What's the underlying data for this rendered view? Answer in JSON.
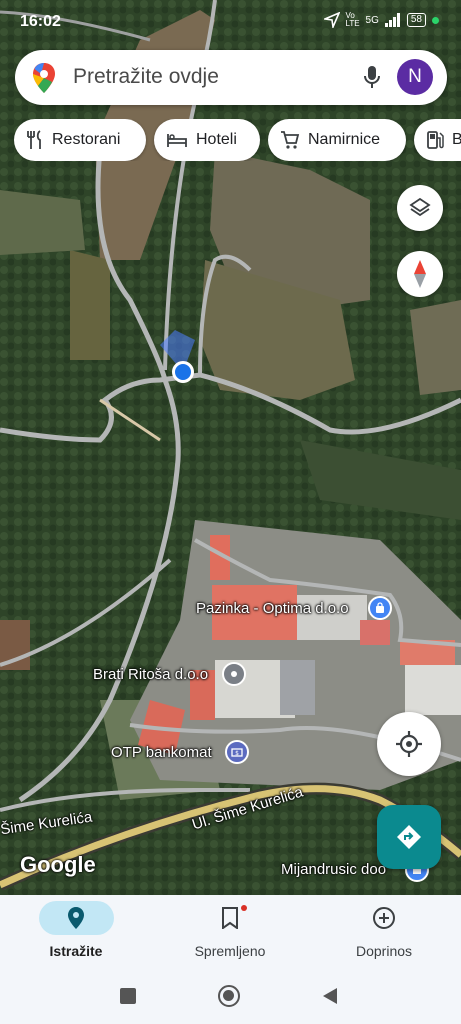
{
  "status_bar": {
    "time": "16:02",
    "volte_label": "Vo LTE",
    "signal_label": "5G",
    "battery": "58",
    "indicator_color": "#2bd46a"
  },
  "search": {
    "placeholder": "Pretražite ovdje",
    "avatar_initial": "N",
    "avatar_color": "#5b2ca3"
  },
  "chips": [
    {
      "label": "Restorani",
      "icon": "restaurant-icon"
    },
    {
      "label": "Hoteli",
      "icon": "hotel-icon"
    },
    {
      "label": "Namirnice",
      "icon": "shopping-cart-icon"
    },
    {
      "label": "B",
      "icon": "gas-station-icon"
    }
  ],
  "map": {
    "places": [
      {
        "name": "Pazinka - Optima d.o.o",
        "icon": "shopping-bag-icon",
        "color": "#4285f4"
      },
      {
        "name": "Brati Ritoša d.o.o",
        "icon": "pin-icon",
        "color": "#7a7f86"
      },
      {
        "name": "OTP bankomat",
        "icon": "atm-icon",
        "color": "#5c6bc0"
      },
      {
        "name": "Mijandrusic doo",
        "icon": "store-icon",
        "color": "#4285f4"
      }
    ],
    "streets": [
      "Šime Kurelića",
      "Ul. Šime Kurelića"
    ],
    "attribution": "Google",
    "location_dot_color": "#1a73e8",
    "directions_color": "#0b8a8f"
  },
  "bottom_nav": [
    {
      "label": "Istražite",
      "icon": "explore-pin-icon",
      "active": true
    },
    {
      "label": "Spremljeno",
      "icon": "bookmark-icon",
      "active": false
    },
    {
      "label": "Doprinos",
      "icon": "add-circle-icon",
      "active": false
    }
  ]
}
